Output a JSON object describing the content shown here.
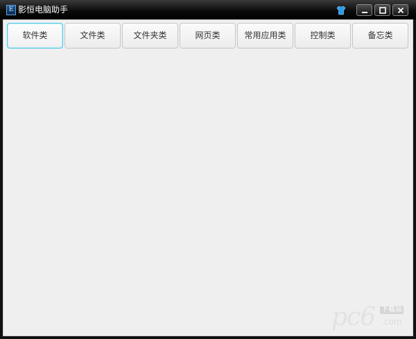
{
  "window": {
    "title": "影恒电脑助手",
    "app_icon_glyph": "E",
    "icons": {
      "app": "app-icon",
      "skin": "skin-shirt-icon",
      "minimize": "minimize-icon",
      "maximize": "maximize-icon",
      "close": "close-icon"
    },
    "colors": {
      "titlebar": "#000000",
      "client_bg": "#efefef",
      "active_tab_border": "#43c8e8",
      "skin_icon": "#2a9be8"
    }
  },
  "tabs": [
    {
      "label": "软件类",
      "active": true
    },
    {
      "label": "文件类",
      "active": false
    },
    {
      "label": "文件夹类",
      "active": false
    },
    {
      "label": "网页类",
      "active": false
    },
    {
      "label": "常用应用类",
      "active": false
    },
    {
      "label": "控制类",
      "active": false
    },
    {
      "label": "备忘类",
      "active": false
    }
  ],
  "watermark": {
    "main": "pc6",
    "cn": "下载站",
    "domain": ".com"
  }
}
